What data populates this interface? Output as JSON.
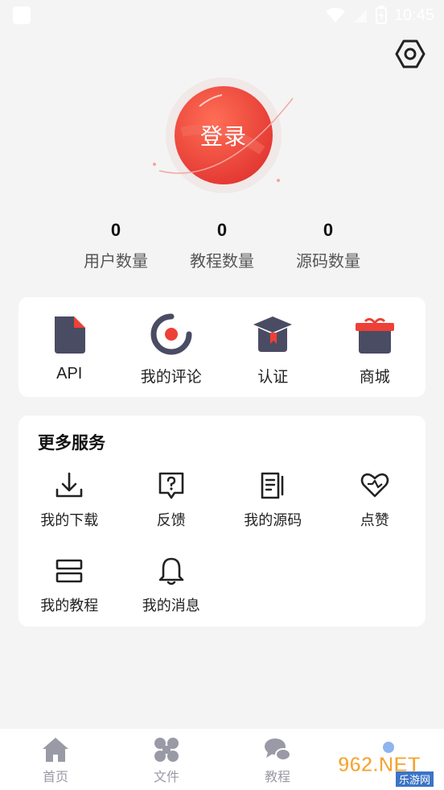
{
  "status_bar": {
    "time": "10:45"
  },
  "header": {
    "settings_icon": "settings-hexagon-icon"
  },
  "login": {
    "label": "登录",
    "color": "#e8403a"
  },
  "stats": [
    {
      "value": "0",
      "label": "用户数量"
    },
    {
      "value": "0",
      "label": "教程数量"
    },
    {
      "value": "0",
      "label": "源码数量"
    }
  ],
  "quick_actions": [
    {
      "label": "API",
      "icon": "document-icon"
    },
    {
      "label": "我的评论",
      "icon": "comment-ring-icon"
    },
    {
      "label": "认证",
      "icon": "graduation-cap-icon"
    },
    {
      "label": "商城",
      "icon": "gift-icon"
    }
  ],
  "services": {
    "title": "更多服务",
    "items": [
      {
        "label": "我的下载",
        "icon": "download-icon"
      },
      {
        "label": "反馈",
        "icon": "feedback-question-icon"
      },
      {
        "label": "我的源码",
        "icon": "source-code-icon"
      },
      {
        "label": "点赞",
        "icon": "heart-like-icon"
      },
      {
        "label": "我的教程",
        "icon": "tutorial-stack-icon"
      },
      {
        "label": "我的消息",
        "icon": "bell-icon"
      }
    ]
  },
  "bottom_nav": [
    {
      "label": "首页",
      "icon": "home-icon"
    },
    {
      "label": "文件",
      "icon": "files-icon"
    },
    {
      "label": "教程",
      "icon": "chat-bubbles-icon"
    }
  ],
  "watermark": {
    "text": "962.NET",
    "subtext": "乐游网"
  },
  "colors": {
    "accent": "#e8403a",
    "icon_dark": "#4a4c63",
    "nav_gray": "#9a9aa6"
  }
}
